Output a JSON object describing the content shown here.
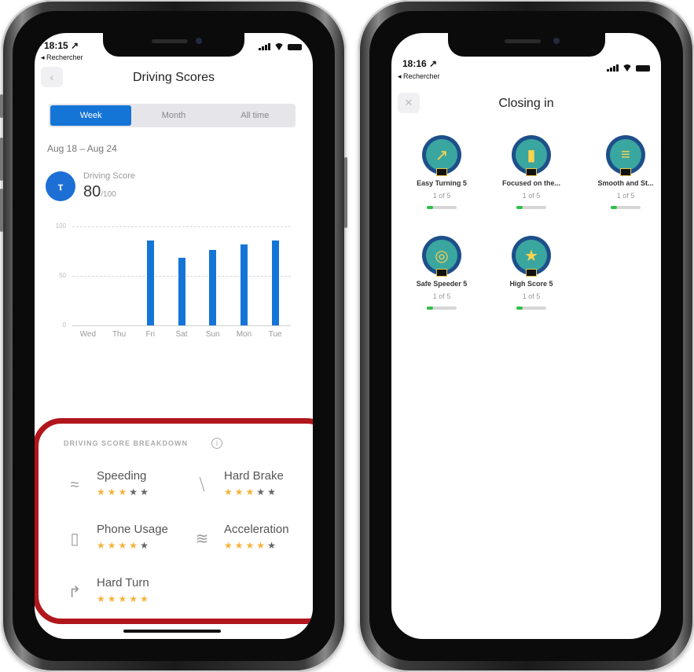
{
  "left": {
    "status": {
      "time": "18:15 ↗",
      "back_label": "◂ Rechercher"
    },
    "nav": {
      "back_icon": "chevron-left-icon",
      "back_glyph": "‹",
      "title": "Driving Scores"
    },
    "segments": [
      {
        "label": "Week",
        "active": true
      },
      {
        "label": "Month",
        "active": false
      },
      {
        "label": "All time",
        "active": false
      }
    ],
    "date_range": "Aug 18 – Aug 24",
    "score": {
      "icon": "route-icon",
      "icon_glyph": "ⲧ",
      "label": "Driving Score",
      "value": "80",
      "out_of": "/100"
    },
    "chart_data": {
      "type": "bar",
      "categories": [
        "Wed",
        "Thu",
        "Fri",
        "Sat",
        "Sun",
        "Mon",
        "Tue"
      ],
      "values": [
        0,
        0,
        86,
        68,
        76,
        82,
        86
      ],
      "yticks": [
        "100",
        "50",
        "0"
      ],
      "ylim": [
        0,
        100
      ],
      "grid": true,
      "color": "#1575d6"
    },
    "breakdown": {
      "title": "DRIVING SCORE BREAKDOWN",
      "info_glyph": "i",
      "metrics": [
        {
          "label": "Speeding",
          "stars": 3,
          "icon": "speedometer-car-icon",
          "glyph": "≈"
        },
        {
          "label": "Hard Brake",
          "stars": 3,
          "icon": "brake-icon",
          "glyph": "⧹"
        },
        {
          "label": "Phone Usage",
          "stars": 4,
          "icon": "phone-icon",
          "glyph": "▯"
        },
        {
          "label": "Acceleration",
          "stars": 4,
          "icon": "acceleration-icon",
          "glyph": "≋"
        },
        {
          "label": "Hard Turn",
          "stars": 5,
          "icon": "turn-arrow-icon",
          "glyph": "↱"
        }
      ]
    }
  },
  "right": {
    "status": {
      "time": "18:16 ↗",
      "back_label": "◂ Rechercher"
    },
    "nav": {
      "close_icon": "close-icon",
      "close_glyph": "✕",
      "title": "Closing in"
    },
    "badges": [
      {
        "name": "Easy Turning 5",
        "progress": "1 of 5",
        "fraction": 0.2,
        "icon": "arrow-badge-icon",
        "glyph": "↗"
      },
      {
        "name": "Focused on the...",
        "progress": "1 of 5",
        "fraction": 0.2,
        "icon": "phone-badge-icon",
        "glyph": "▮"
      },
      {
        "name": "Smooth and St...",
        "progress": "1 of 5",
        "fraction": 0.2,
        "icon": "road-badge-icon",
        "glyph": "≡"
      },
      {
        "name": "Safe Speeder 5",
        "progress": "1 of 5",
        "fraction": 0.2,
        "icon": "speed-badge-icon",
        "glyph": "◎"
      },
      {
        "name": "High Score 5",
        "progress": "1 of 5",
        "fraction": 0.2,
        "icon": "star-badge-icon",
        "glyph": "★"
      }
    ]
  }
}
